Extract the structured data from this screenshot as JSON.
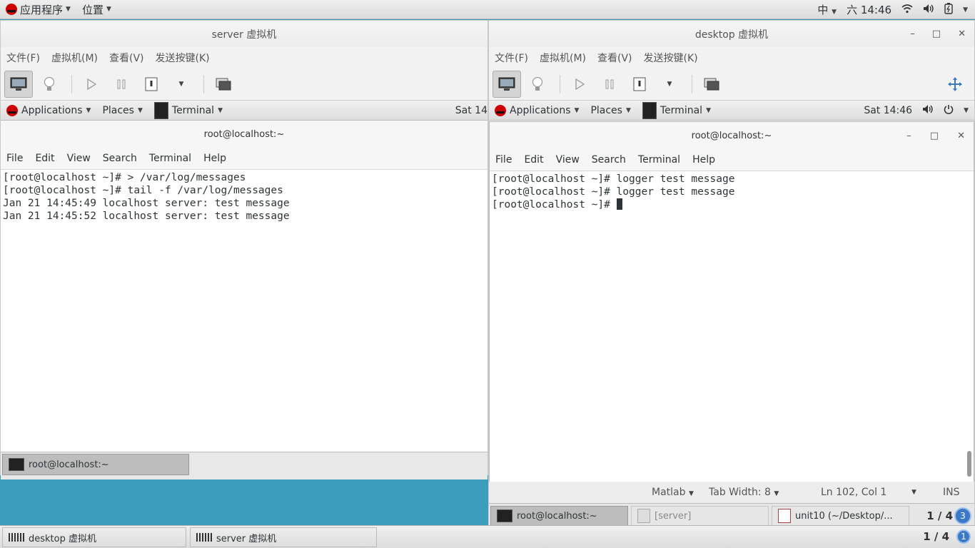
{
  "top_panel": {
    "applications": "应用程序",
    "places": "位置",
    "input_method": "中",
    "clock": "六 14:46"
  },
  "server_window": {
    "title": "server 虚拟机",
    "menu": [
      "文件(F)",
      "虚拟机(M)",
      "查看(V)",
      "发送按键(K)"
    ],
    "guest_panel": {
      "applications": "Applications",
      "places": "Places",
      "terminal": "Terminal",
      "clock": "Sat 14"
    },
    "terminal": {
      "title": "root@localhost:~",
      "menu": [
        "File",
        "Edit",
        "View",
        "Search",
        "Terminal",
        "Help"
      ],
      "lines": [
        "[root@localhost ~]# > /var/log/messages",
        "[root@localhost ~]# tail -f /var/log/messages",
        "Jan 21 14:45:49 localhost server: test message",
        "Jan 21 14:45:52 localhost server: test message"
      ]
    },
    "taskbar_item": "root@localhost:~"
  },
  "desktop_window": {
    "title": "desktop 虚拟机",
    "menu": [
      "文件(F)",
      "虚拟机(M)",
      "查看(V)",
      "发送按键(K)"
    ],
    "guest_panel": {
      "applications": "Applications",
      "places": "Places",
      "terminal": "Terminal",
      "clock": "Sat 14:46"
    },
    "terminal": {
      "title": "root@localhost:~",
      "menu": [
        "File",
        "Edit",
        "View",
        "Search",
        "Terminal",
        "Help"
      ],
      "lines": [
        "[root@localhost ~]# logger test message",
        "[root@localhost ~]# logger test message",
        "[root@localhost ~]# "
      ]
    },
    "statusbar": {
      "language": "Matlab",
      "tab_width": "Tab Width: 8",
      "position": "Ln 102, Col 1",
      "mode": "INS"
    },
    "taskbar": {
      "items": [
        "root@localhost:~",
        "[server]",
        "unit10 (~/Desktop/..."
      ],
      "workspace": "1 / 4",
      "badge": "3"
    }
  },
  "bottom_bar": {
    "items": [
      "desktop 虚拟机",
      "server 虚拟机"
    ],
    "workspace": "1 / 4",
    "badge": "1"
  }
}
